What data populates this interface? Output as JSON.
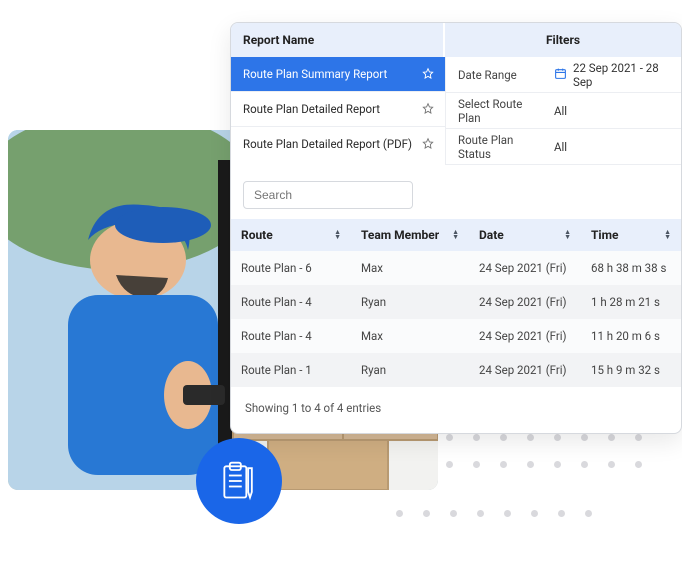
{
  "header": {
    "report_name": "Report Name",
    "filters": "Filters"
  },
  "reports": {
    "items": [
      {
        "label": "Route Plan Summary Report"
      },
      {
        "label": "Route Plan Detailed Report"
      },
      {
        "label": "Route Plan Detailed Report (PDF)"
      }
    ]
  },
  "filters": {
    "rows": [
      {
        "label": "Date Range",
        "value": "22 Sep 2021 - 28 Sep",
        "icon": "calendar"
      },
      {
        "label": "Select Route Plan",
        "value": "All"
      },
      {
        "label": "Route Plan Status",
        "value": "All"
      }
    ]
  },
  "search": {
    "placeholder": "Search"
  },
  "table": {
    "columns": {
      "route": "Route",
      "member": "Team Member",
      "date": "Date",
      "time": "Time"
    },
    "rows": [
      {
        "route": "Route Plan - 6",
        "member": "Max",
        "date": "24 Sep 2021 (Fri)",
        "time": "68 h 38 m 38 s"
      },
      {
        "route": "Route Plan - 4",
        "member": "Ryan",
        "date": "24 Sep 2021 (Fri)",
        "time": "1 h 28 m 21 s"
      },
      {
        "route": "Route Plan - 4",
        "member": "Max",
        "date": "24 Sep 2021 (Fri)",
        "time": "11 h 20 m 6 s"
      },
      {
        "route": "Route Plan - 1",
        "member": "Ryan",
        "date": "24 Sep 2021 (Fri)",
        "time": "15 h 9 m 32 s"
      }
    ],
    "footer": "Showing 1 to 4 of 4 entries"
  },
  "colors": {
    "accent": "#2d75e8",
    "badge": "#1a66e8",
    "header_bg": "#e8effb"
  }
}
